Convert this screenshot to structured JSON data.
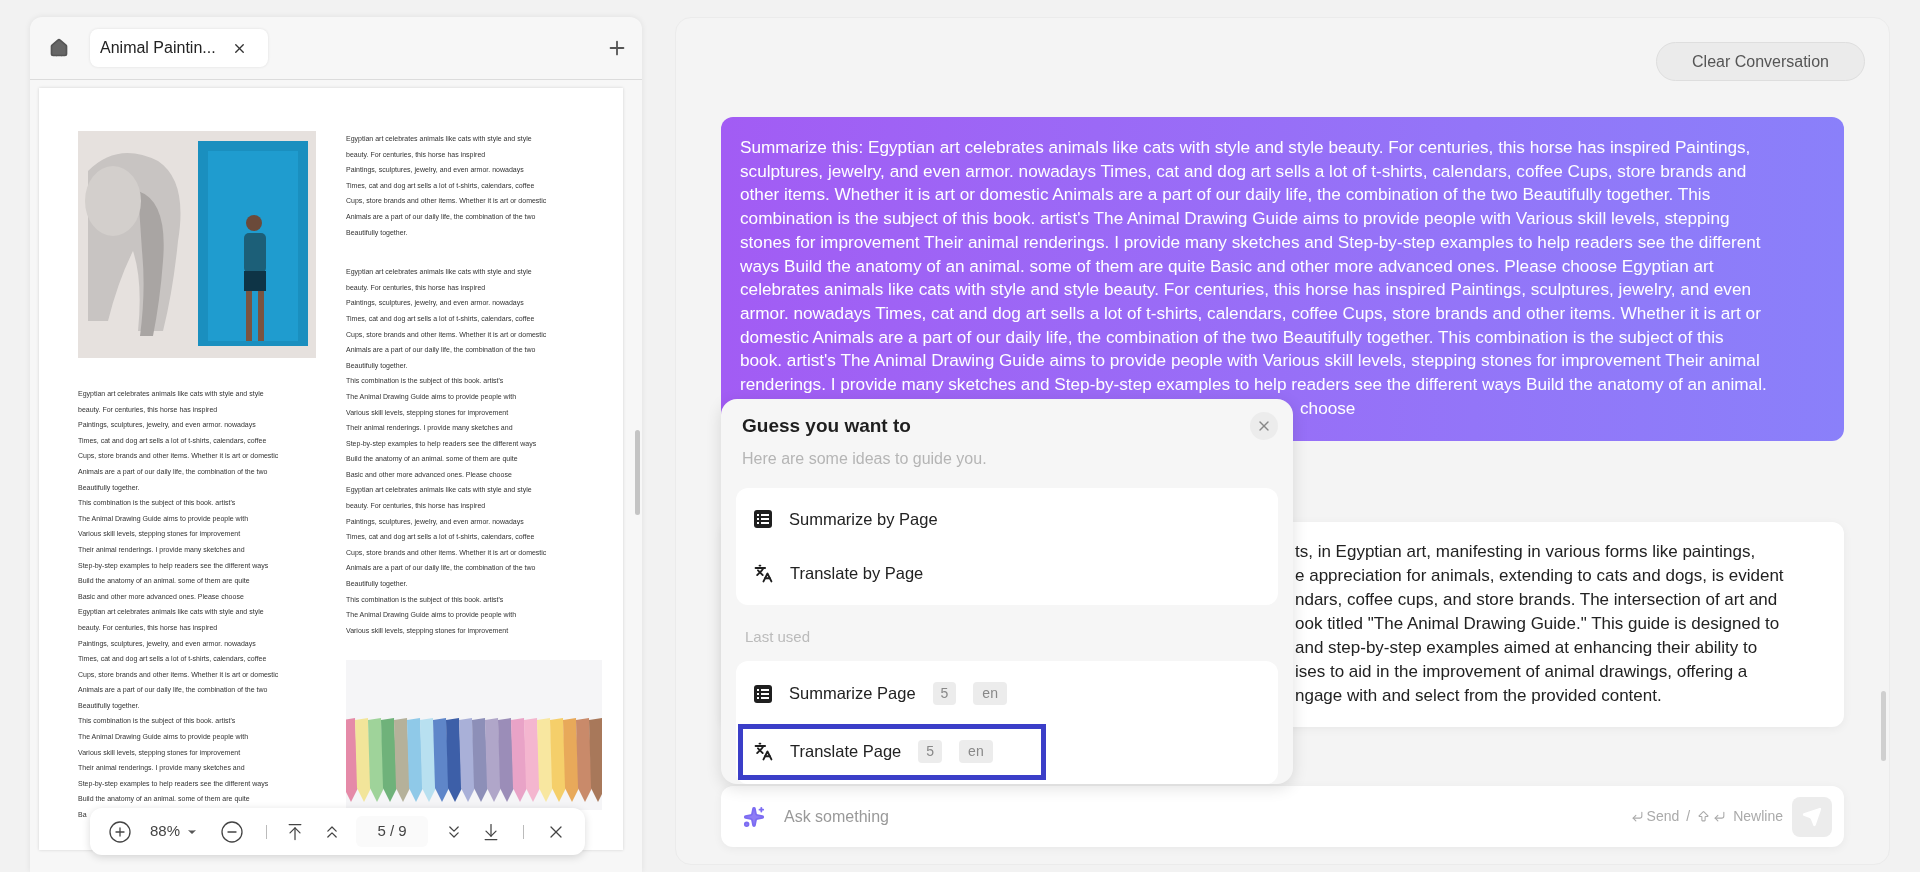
{
  "pdf_viewer": {
    "tabs": [
      {
        "label": "Animal Paintin...",
        "selected": true
      }
    ],
    "page": {
      "left_column": [
        "Egyptian art celebrates animals like cats with style and style",
        "beauty. For centuries, this horse has inspired",
        "Paintings, sculptures, jewelry, and even armor. nowadays",
        "Times, cat and dog art sells a lot of t-shirts, calendars, coffee",
        "Cups, store brands and other items. Whether it is art or domestic",
        "Animals are a part of our daily life, the combination of the two",
        "Beautifully together.",
        "This combination is the subject of this book. artist's",
        "The Animal Drawing Guide aims to provide people with",
        "Various skill levels, stepping stones for improvement",
        "Their animal renderings. I provide many sketches and",
        "Step-by-step examples to help readers see the different ways",
        "Build the anatomy of an animal. some of them are quite",
        "Basic and other more advanced ones. Please choose",
        "Egyptian art celebrates animals like cats with style and style",
        "beauty. For centuries, this horse has inspired",
        "Paintings, sculptures, jewelry, and even armor. nowadays",
        "Times, cat and dog art sells a lot of t-shirts, calendars, coffee",
        "Cups, store brands and other items. Whether it is art or domestic",
        "Animals are a part of our daily life, the combination of the two",
        "Beautifully together.",
        "This combination is the subject of this book. artist's",
        "The Animal Drawing Guide aims to provide people with",
        "Various skill levels, stepping stones for improvement",
        "Their animal renderings. I provide many sketches and",
        "Step-by-step examples to help readers see the different ways",
        "Build the anatomy of an animal. some of them are quite",
        "Ba"
      ],
      "right_column_blocks": [
        [
          "Egyptian art celebrates animals like cats with style and style",
          "beauty. For centuries, this horse has inspired",
          "Paintings, sculptures, jewelry, and even armor. nowadays",
          "Times, cat and dog art sells a lot of t-shirts, calendars, coffee",
          "Cups, store brands and other items. Whether it is art or domestic",
          "Animals are a part of our daily life, the combination of the two",
          "Beautifully together."
        ],
        [
          "Egyptian art celebrates animals like cats with style and style",
          "beauty. For centuries, this horse has inspired",
          "Paintings, sculptures, jewelry, and even armor. nowadays",
          "Times, cat and dog art sells a lot of t-shirts, calendars, coffee",
          "Cups, store brands and other items. Whether it is art or domestic",
          "Animals are a part of our daily life, the combination of the two",
          "Beautifully together.",
          "This combination is the subject of this book. artist's",
          "The Animal Drawing Guide aims to provide people with",
          "Various skill levels, stepping stones for improvement",
          "Their animal renderings. I provide many sketches and",
          "Step-by-step examples to help readers see the different ways",
          "Build the anatomy of an animal. some of them are quite",
          "Basic and other more advanced ones. Please choose",
          "Egyptian art celebrates animals like cats with style and style",
          "beauty. For centuries, this horse has inspired",
          "Paintings, sculptures, jewelry, and even armor. nowadays",
          "Times, cat and dog art sells a lot of t-shirts, calendars, coffee",
          "Cups, store brands and other items. Whether it is art or domestic",
          "Animals are a part of our daily life, the combination of the two",
          "Beautifully together.",
          "This combination is the subject of this book. artist's",
          "The Animal Drawing Guide aims to provide people with",
          "Various skill levels, stepping stones for improvement"
        ]
      ]
    },
    "toolbar": {
      "zoom": "88%",
      "page": "5 / 9"
    }
  },
  "chat": {
    "clear_button": "Clear Conversation",
    "message_lines": [
      "Summarize this: Egyptian art celebrates animals like cats with style and style beauty. For centuries, this horse has inspired Paintings,",
      "sculptures, jewelry, and even armor. nowadays Times, cat and dog art sells a lot of t-shirts, calendars, coffee Cups, store brands and",
      "other items. Whether it is art or domestic Animals are a part of our daily life, the combination of the two Beautifully together. This",
      "combination is the subject of this book. artist's The Animal Drawing Guide aims to provide people with Various skill levels, stepping",
      "stones for improvement Their animal renderings. I provide many sketches and Step-by-step examples to help readers see the different",
      "ways Build the anatomy of an animal. some of them are quite Basic and other more advanced ones. Please choose Egyptian art",
      "celebrates animals like cats with style and style beauty. For centuries, this horse has inspired Paintings, sculptures, jewelry, and even",
      "armor. nowadays Times, cat and dog art sells a lot of t-shirts, calendars, coffee Cups, store brands and other items. Whether it is art or",
      "domestic Animals are a part of our daily life, the combination of the two Beautifully together. This combination is the subject of this",
      "book. artist's The Animal Drawing Guide aims to provide people with Various skill levels, stepping stones for improvement Their animal",
      "renderings. I provide many sketches and Step-by-step examples to help readers see the different ways Build the anatomy of an animal."
    ],
    "message_tail": "choose",
    "answer_lines": [
      "ts, in Egyptian art, manifesting in various forms like paintings,",
      "e appreciation for animals, extending to cats and dogs, is evident",
      "ndars, coffee cups, and store brands. The intersection of art and",
      "ook titled \"The Animal Drawing Guide.\" This guide is designed to",
      "and step-by-step examples aimed at enhancing their ability to",
      "ises to aid in the improvement of animal drawings, offering a",
      "ngage with and select from the provided content."
    ],
    "input": {
      "placeholder": "Ask something",
      "send_hint": "Send",
      "separator": "/",
      "newline_hint": "Newline"
    }
  },
  "suggestions_popup": {
    "title": "Guess you want to",
    "subtitle": "Here are some ideas to guide you.",
    "suggestions": [
      {
        "kind": "summarize",
        "label": "Summarize by Page"
      },
      {
        "kind": "translate",
        "label": "Translate by Page"
      }
    ],
    "last_used_heading": "Last used",
    "last_used": [
      {
        "kind": "summarize",
        "label": "Summarize Page",
        "pages": "5",
        "language": "en",
        "highlighted": false
      },
      {
        "kind": "translate",
        "label": "Translate Page",
        "pages": "5",
        "language": "en",
        "highlighted": true
      }
    ]
  }
}
